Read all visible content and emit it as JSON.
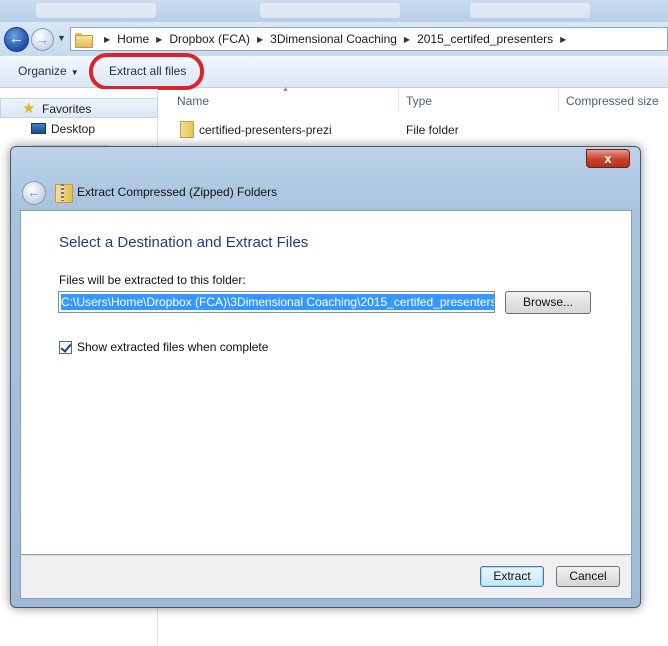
{
  "explorer": {
    "breadcrumb": [
      "Home",
      "Dropbox (FCA)",
      "3Dimensional Coaching",
      "2015_certifed_presenters"
    ],
    "toolbar": {
      "organize": "Organize",
      "extract_all": "Extract all files"
    },
    "nav": {
      "favorites": "Favorites",
      "desktop": "Desktop"
    },
    "columns": {
      "name": "Name",
      "type": "Type",
      "compressed_size": "Compressed size"
    },
    "rows": [
      {
        "name": "certified-presenters-prezi",
        "type": "File folder"
      }
    ]
  },
  "dialog": {
    "title": "Extract Compressed (Zipped) Folders",
    "heading": "Select a Destination and Extract Files",
    "path_label": "Files will be extracted to this folder:",
    "path_value": "C:\\Users\\Home\\Dropbox (FCA)\\3Dimensional Coaching\\2015_certifed_presenters",
    "browse_label": "Browse...",
    "checkbox_label": "Show extracted files when complete",
    "checkbox_checked": true,
    "extract_label": "Extract",
    "cancel_label": "Cancel",
    "close_glyph": "x"
  },
  "colors": {
    "highlight_ring": "#e0212b",
    "heading": "#1e3d87",
    "selection": "#3399ff"
  }
}
